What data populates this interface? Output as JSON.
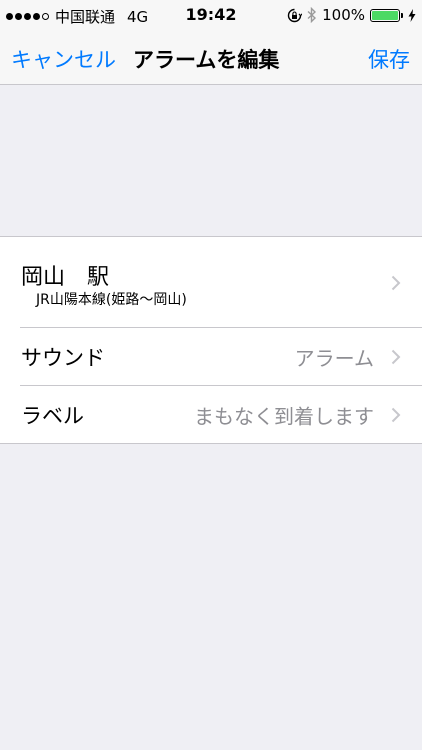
{
  "status_bar": {
    "carrier": "中国联通",
    "network": "4G",
    "time": "19:42",
    "battery": "100%",
    "battery_level": 1.0,
    "battery_color": "#4cd964"
  },
  "nav": {
    "cancel_label": "キャンセル",
    "title": "アラームを編集",
    "save_label": "保存",
    "accent_color": "#007aff"
  },
  "rows": {
    "station": {
      "name": "岡山　駅",
      "line": "JR山陽本線(姫路～岡山)"
    },
    "sound": {
      "title": "サウンド",
      "value": "アラーム"
    },
    "label": {
      "title": "ラベル",
      "value": "まもなく到着します"
    }
  },
  "icons": {
    "signal": "signal-dots-icon",
    "orientation_lock": "orientation-lock-icon",
    "bluetooth": "bluetooth-icon",
    "battery": "battery-icon",
    "charging": "charging-bolt-icon",
    "chevron": "chevron-right-icon"
  }
}
